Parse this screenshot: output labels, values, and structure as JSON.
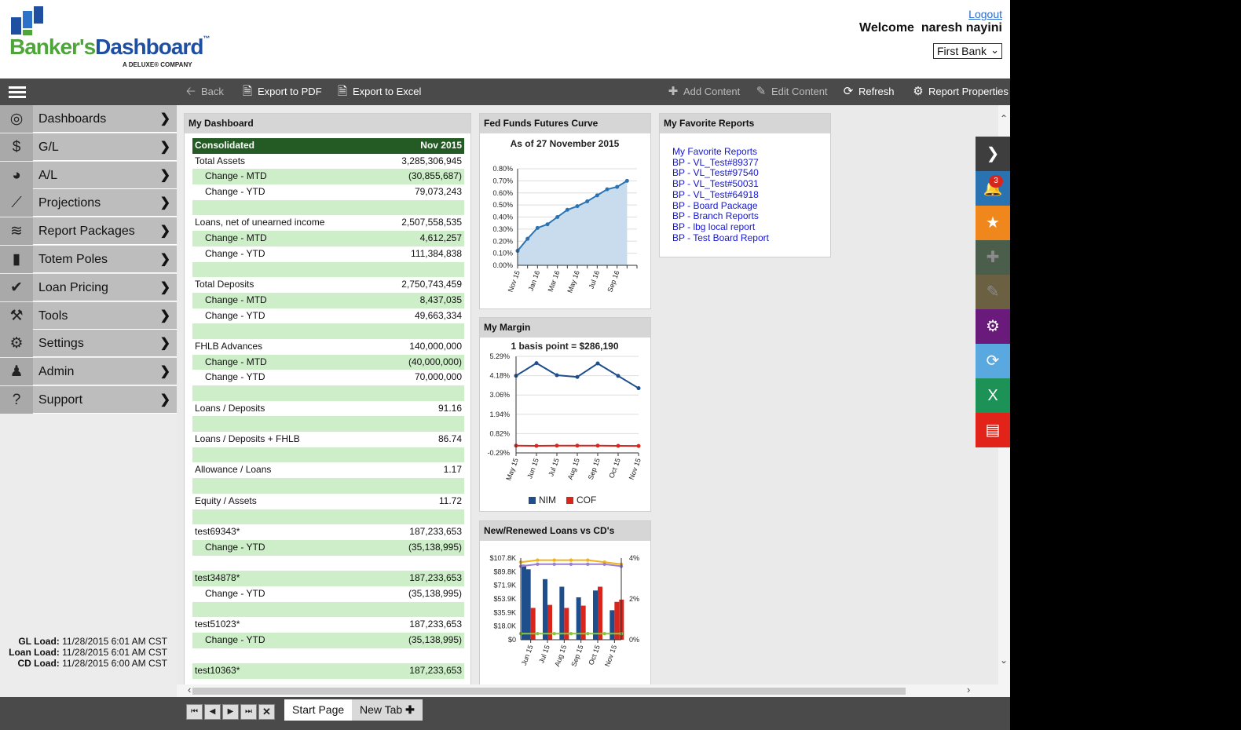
{
  "header": {
    "logo_text_a": "Banker's",
    "logo_text_b": "Dashboard",
    "logo_tm": "™",
    "logo_sub": "A DELUXE® COMPANY",
    "logout": "Logout",
    "welcome": "Welcome  naresh nayini",
    "bank": "First Bank"
  },
  "toolbar": {
    "back": "Back",
    "export_pdf": "Export to PDF",
    "export_excel": "Export to Excel",
    "add_content": "Add Content",
    "edit_content": "Edit Content",
    "refresh": "Refresh",
    "report_properties": "Report Properties"
  },
  "sidebar": {
    "items": [
      {
        "label": "Dashboards",
        "icon": "dashboard-icon"
      },
      {
        "label": "G/L",
        "icon": "dollar-icon"
      },
      {
        "label": "A/L",
        "icon": "pie-icon"
      },
      {
        "label": "Projections",
        "icon": "line-chart-icon"
      },
      {
        "label": "Report Packages",
        "icon": "layers-icon"
      },
      {
        "label": "Totem Poles",
        "icon": "bar-chart-icon"
      },
      {
        "label": "Loan Pricing",
        "icon": "check-icon"
      },
      {
        "label": "Tools",
        "icon": "hammer-icon"
      },
      {
        "label": "Settings",
        "icon": "gear-icon"
      },
      {
        "label": "Admin",
        "icon": "user-icon"
      },
      {
        "label": "Support",
        "icon": "question-icon"
      }
    ],
    "loads": {
      "gl_label": "GL Load:",
      "gl_value": " 11/28/2015 6:01 AM CST",
      "loan_label": "Loan Load:",
      "loan_value": " 11/28/2015 6:01 AM CST",
      "cd_label": "CD Load:",
      "cd_value": " 11/28/2015 6:00 AM CST"
    }
  },
  "dashboard": {
    "title": "My Dashboard",
    "header": {
      "label": "Consolidated",
      "value": "Nov 2015"
    },
    "rows": [
      {
        "label": "Total Assets",
        "value": "3,285,306,945",
        "indent": false,
        "green": false
      },
      {
        "label": "Change - MTD",
        "value": "(30,855,687)",
        "indent": true,
        "green": true
      },
      {
        "label": "Change - YTD",
        "value": "79,073,243",
        "indent": true,
        "green": false
      },
      {
        "label": "",
        "value": "",
        "indent": false,
        "green": true
      },
      {
        "label": "Loans, net of unearned income",
        "value": "2,507,558,535",
        "indent": false,
        "green": false
      },
      {
        "label": "Change - MTD",
        "value": "4,612,257",
        "indent": true,
        "green": true
      },
      {
        "label": "Change - YTD",
        "value": "111,384,838",
        "indent": true,
        "green": false
      },
      {
        "label": "",
        "value": "",
        "indent": false,
        "green": true
      },
      {
        "label": "Total Deposits",
        "value": "2,750,743,459",
        "indent": false,
        "green": false
      },
      {
        "label": "Change - MTD",
        "value": "8,437,035",
        "indent": true,
        "green": true
      },
      {
        "label": "Change - YTD",
        "value": "49,663,334",
        "indent": true,
        "green": false
      },
      {
        "label": "",
        "value": "",
        "indent": false,
        "green": true
      },
      {
        "label": "FHLB Advances",
        "value": "140,000,000",
        "indent": false,
        "green": false
      },
      {
        "label": "Change - MTD",
        "value": "(40,000,000)",
        "indent": true,
        "green": true
      },
      {
        "label": "Change - YTD",
        "value": "70,000,000",
        "indent": true,
        "green": false
      },
      {
        "label": "",
        "value": "",
        "indent": false,
        "green": true
      },
      {
        "label": "Loans / Deposits",
        "value": "91.16",
        "indent": false,
        "green": false
      },
      {
        "label": "",
        "value": "",
        "indent": false,
        "green": true
      },
      {
        "label": "Loans / Deposits + FHLB",
        "value": "86.74",
        "indent": false,
        "green": false
      },
      {
        "label": "",
        "value": "",
        "indent": false,
        "green": true
      },
      {
        "label": "Allowance / Loans",
        "value": "1.17",
        "indent": false,
        "green": false
      },
      {
        "label": "",
        "value": "",
        "indent": false,
        "green": true
      },
      {
        "label": "Equity / Assets",
        "value": "11.72",
        "indent": false,
        "green": false
      },
      {
        "label": "",
        "value": "",
        "indent": false,
        "green": true
      },
      {
        "label": "test69343*",
        "value": "187,233,653",
        "indent": false,
        "green": false
      },
      {
        "label": "Change - YTD",
        "value": "(35,138,995)",
        "indent": true,
        "green": true
      },
      {
        "label": "",
        "value": "",
        "indent": false,
        "green": false
      },
      {
        "label": "test34878*",
        "value": "187,233,653",
        "indent": false,
        "green": true
      },
      {
        "label": "Change - YTD",
        "value": "(35,138,995)",
        "indent": true,
        "green": false
      },
      {
        "label": "",
        "value": "",
        "indent": false,
        "green": true
      },
      {
        "label": "test51023*",
        "value": "187,233,653",
        "indent": false,
        "green": false
      },
      {
        "label": "Change - YTD",
        "value": "(35,138,995)",
        "indent": true,
        "green": true
      },
      {
        "label": "",
        "value": "",
        "indent": false,
        "green": false
      },
      {
        "label": "test10363*",
        "value": "187,233,653",
        "indent": false,
        "green": true
      }
    ]
  },
  "favorites": {
    "title": "My Favorite Reports",
    "links": [
      "My Favorite Reports",
      "BP - VL_Test#89377",
      "BP - VL_Test#97540",
      "BP - VL_Test#50031",
      "BP - VL_Test#64918",
      "BP - Board Package",
      "BP - Branch Reports",
      "BP - lbg local report",
      "BP - Test Board Report"
    ]
  },
  "panels": {
    "fed_title": "Fed Funds Futures Curve",
    "margin_title": "My Margin",
    "loans_title": "New/Renewed Loans vs CD's"
  },
  "chart_data": [
    {
      "type": "area",
      "title": "As of 27 November 2015",
      "x": [
        "Nov 15",
        "Dec 15",
        "Jan 16",
        "Feb 16",
        "Mar 16",
        "Apr 16",
        "May 16",
        "Jun 16",
        "Jul 16",
        "Aug 16",
        "Sep 16",
        "Oct 16",
        "Nov 16"
      ],
      "x_tick_labels": [
        "Nov 15",
        "Jan 16",
        "Mar 16",
        "May 16",
        "Jul 16",
        "Sep 16"
      ],
      "values": [
        0.12,
        0.22,
        0.31,
        0.34,
        0.4,
        0.46,
        0.49,
        0.53,
        0.58,
        0.63,
        0.65,
        0.7
      ],
      "yticks": [
        "0.00%",
        "0.10%",
        "0.20%",
        "0.30%",
        "0.40%",
        "0.50%",
        "0.60%",
        "0.70%",
        "0.80%"
      ],
      "ylim": [
        0,
        0.8
      ],
      "color": "#2a73b3",
      "fill": "#c8dcee",
      "grid": true
    },
    {
      "type": "line",
      "title": "1 basis point = $286,190",
      "categories": [
        "May 15",
        "Jun 15",
        "Jul 15",
        "Aug 15",
        "Sep 15",
        "Oct 15",
        "Nov 15"
      ],
      "yticks": [
        "-0.29%",
        "0.82%",
        "1.94%",
        "3.06%",
        "4.18%",
        "5.29%"
      ],
      "ylim": [
        -0.29,
        5.29
      ],
      "series": [
        {
          "name": "NIM",
          "color": "#1f4e8c",
          "values": [
            4.17,
            4.9,
            4.2,
            4.1,
            4.88,
            4.16,
            3.45
          ]
        },
        {
          "name": "COF",
          "color": "#d9261c",
          "values": [
            0.13,
            0.12,
            0.13,
            0.13,
            0.13,
            0.12,
            0.11
          ]
        }
      ],
      "legend": "bottom",
      "grid": true
    },
    {
      "type": "bar",
      "categories": [
        "Jun 15",
        "Jul 15",
        "Aug 15",
        "Sep 15",
        "Oct 15",
        "Nov 15"
      ],
      "yticks_left": [
        "$0",
        "$18.0K",
        "$35.9K",
        "$53.9K",
        "$71.9K",
        "$89.8K",
        "$107.8K"
      ],
      "yticks_right": [
        "0%",
        "2%",
        "4%"
      ],
      "ylim_left": [
        0,
        107.8
      ],
      "ylim_right": [
        0,
        4
      ],
      "bars_pairs": [
        {
          "color": "#1f4e8c",
          "values": [
            93,
            80,
            70,
            56,
            65,
            39
          ]
        },
        {
          "color": "#d9261c",
          "values": [
            42,
            46,
            42,
            45,
            70,
            50
          ]
        }
      ],
      "extra_bars": [
        {
          "color": "#1f4e8c",
          "index": 0,
          "value": 99
        },
        {
          "color": "#d9261c",
          "index": 5,
          "value": 53
        }
      ],
      "lines_right": [
        {
          "color": "#f0b21e",
          "values": [
            3.8,
            3.9,
            3.9,
            3.9,
            3.9,
            3.8,
            3.7
          ]
        },
        {
          "color": "#9b7fd1",
          "values": [
            3.6,
            3.7,
            3.7,
            3.7,
            3.7,
            3.7,
            3.6
          ]
        },
        {
          "color": "#8cc63f",
          "values": [
            0.3,
            0.3,
            0.3,
            0.3,
            0.3,
            0.3,
            0.3
          ]
        }
      ]
    }
  ],
  "bottom": {
    "tabs": [
      "Start Page",
      "New Tab"
    ]
  },
  "rail": {
    "badge": "3",
    "buttons": [
      {
        "icon": "chevron-right-icon",
        "color": "#3e3e3e"
      },
      {
        "icon": "bell-icon",
        "color": "#2a73b3"
      },
      {
        "icon": "star-icon",
        "color": "#f0871c"
      },
      {
        "icon": "plus-icon",
        "color": "#4b5d4b"
      },
      {
        "icon": "pencil-icon",
        "color": "#6b6042"
      },
      {
        "icon": "gear-icon",
        "color": "#6a1a7a"
      },
      {
        "icon": "refresh-icon",
        "color": "#5aa8e0"
      },
      {
        "icon": "excel-icon",
        "color": "#1d9257"
      },
      {
        "icon": "pdf-icon",
        "color": "#e2231a"
      }
    ]
  }
}
